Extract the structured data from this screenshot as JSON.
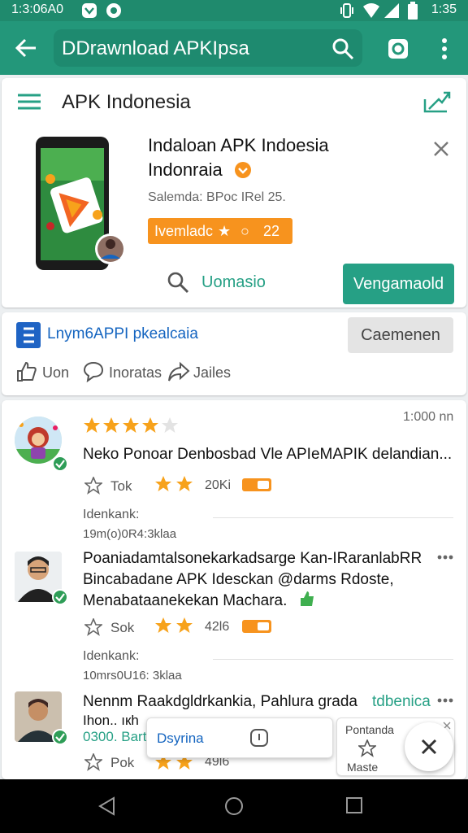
{
  "status_bar": {
    "time_left": "1:3:06A0",
    "time_right": "1:35"
  },
  "app_bar": {
    "search_text": "DDrawnload APKIpsa"
  },
  "header": {
    "title": "APK Indonesia"
  },
  "app_card": {
    "name_line1": "Indaloan APK Indoesia",
    "name_line2": "Indonraia",
    "subtitle": "Salemda: BPoc IRel 25.",
    "badge": "Ivemladc",
    "badge_num": "22",
    "search_label": "Uomasio",
    "install_button": "Vengamaold"
  },
  "share_card": {
    "title": "Lnym6APPI pkealcaia",
    "comment_button": "Caemenen",
    "action_like": "Uon",
    "action_comment": "Inoratas",
    "action_share": "Jailes"
  },
  "reviews": {
    "first": {
      "time": "1:000 nn",
      "rating": 4,
      "text": "Neko Ponoar Denbosbad Vle APIeMAPIK delandian...",
      "action": "Tok",
      "count": "20Ki",
      "meta1": "Idenkank:",
      "meta2": "19m(o)0R4:3klaa"
    },
    "second": {
      "text1": "Poaniadamtalsonekarkadsarge Kan-IRaranlabRR",
      "text2": "Bincabadane APK Idesckan @darms Rdoste,",
      "text3": "Menabataanekekan Machara.",
      "action": "Sok",
      "count": "42l6",
      "meta1": "Idenkank:",
      "meta2": "10mrs0U16: 3klaa"
    },
    "third": {
      "text1": "Nennm Raakdgldrkankia, Pahlura grada",
      "text_link": "tdbenica",
      "text2": "Ihon.. ıкh",
      "link2": "0300. Bartl",
      "action": "Pok",
      "count": "49l6"
    }
  },
  "popup": {
    "label": "Dsyrina"
  },
  "mini_card": {
    "title": "Pontanda",
    "label": "Maste"
  },
  "colors": {
    "teal": "#23977a",
    "teal_dark": "#1f8a6d",
    "orange": "#f7931e",
    "star": "#f7a21b",
    "blue": "#1565c0"
  }
}
